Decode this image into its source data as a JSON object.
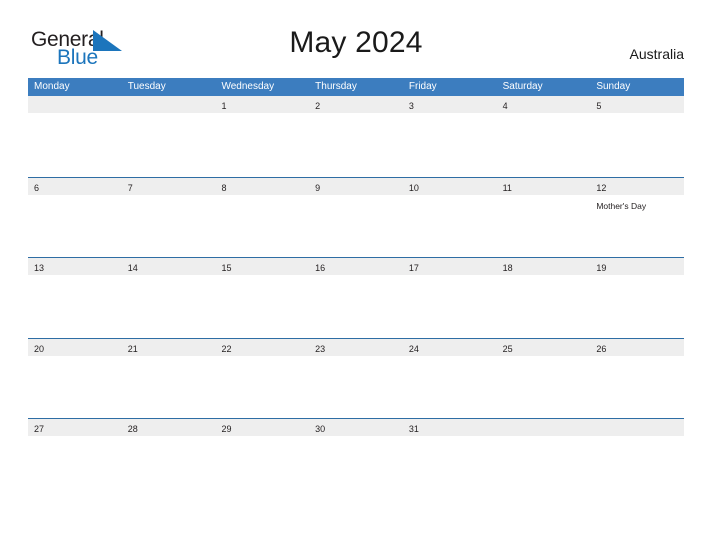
{
  "brand": {
    "name_part1": "General",
    "name_part2": "Blue",
    "flag_icon": "triangle-flag-icon",
    "color_dark": "#231f20",
    "color_blue": "#1c75bc"
  },
  "header": {
    "title": "May 2024",
    "country": "Australia"
  },
  "theme": {
    "header_blue": "#3c7dbf",
    "row_band_gray": "#eeeeee",
    "row_rule_blue": "#2e6da4",
    "page_background": "#ffffff",
    "text_color": "#231f20"
  },
  "calendar": {
    "weekday_headers": [
      "Monday",
      "Tuesday",
      "Wednesday",
      "Thursday",
      "Friday",
      "Saturday",
      "Sunday"
    ],
    "weeks": [
      {
        "days": [
          {
            "date": "",
            "event": ""
          },
          {
            "date": "",
            "event": ""
          },
          {
            "date": "1",
            "event": ""
          },
          {
            "date": "2",
            "event": ""
          },
          {
            "date": "3",
            "event": ""
          },
          {
            "date": "4",
            "event": ""
          },
          {
            "date": "5",
            "event": ""
          }
        ]
      },
      {
        "days": [
          {
            "date": "6",
            "event": ""
          },
          {
            "date": "7",
            "event": ""
          },
          {
            "date": "8",
            "event": ""
          },
          {
            "date": "9",
            "event": ""
          },
          {
            "date": "10",
            "event": ""
          },
          {
            "date": "11",
            "event": ""
          },
          {
            "date": "12",
            "event": "Mother's Day"
          }
        ]
      },
      {
        "days": [
          {
            "date": "13",
            "event": ""
          },
          {
            "date": "14",
            "event": ""
          },
          {
            "date": "15",
            "event": ""
          },
          {
            "date": "16",
            "event": ""
          },
          {
            "date": "17",
            "event": ""
          },
          {
            "date": "18",
            "event": ""
          },
          {
            "date": "19",
            "event": ""
          }
        ]
      },
      {
        "days": [
          {
            "date": "20",
            "event": ""
          },
          {
            "date": "21",
            "event": ""
          },
          {
            "date": "22",
            "event": ""
          },
          {
            "date": "23",
            "event": ""
          },
          {
            "date": "24",
            "event": ""
          },
          {
            "date": "25",
            "event": ""
          },
          {
            "date": "26",
            "event": ""
          }
        ]
      },
      {
        "days": [
          {
            "date": "27",
            "event": ""
          },
          {
            "date": "28",
            "event": ""
          },
          {
            "date": "29",
            "event": ""
          },
          {
            "date": "30",
            "event": ""
          },
          {
            "date": "31",
            "event": ""
          },
          {
            "date": "",
            "event": ""
          },
          {
            "date": "",
            "event": ""
          }
        ]
      }
    ]
  }
}
